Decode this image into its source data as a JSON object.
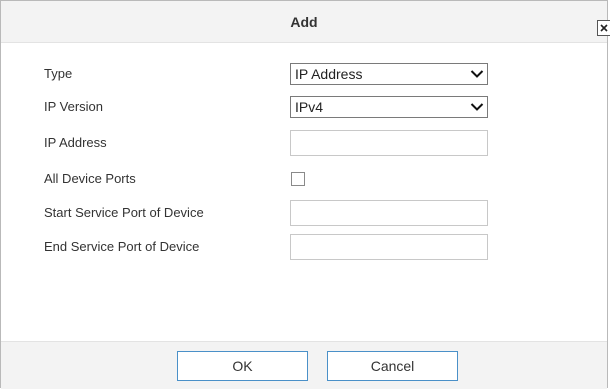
{
  "dialog": {
    "title": "Add",
    "close_icon": "close-icon"
  },
  "form": {
    "type": {
      "label": "Type",
      "value": "IP Address"
    },
    "ip_version": {
      "label": "IP Version",
      "value": "IPv4"
    },
    "ip_address": {
      "label": "IP Address",
      "value": "",
      "placeholder": ""
    },
    "all_device_ports": {
      "label": "All Device Ports",
      "checked": false
    },
    "start_service_port": {
      "label": "Start Service Port of Device",
      "value": "",
      "placeholder": ""
    },
    "end_service_port": {
      "label": "End Service Port of Device",
      "value": "",
      "placeholder": ""
    }
  },
  "footer": {
    "ok_label": "OK",
    "cancel_label": "Cancel"
  },
  "colors": {
    "button_border": "#4a90c8",
    "header_bg": "#f3f3f3"
  }
}
